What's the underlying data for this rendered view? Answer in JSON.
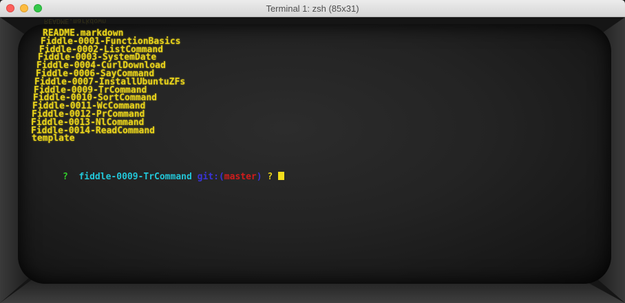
{
  "window": {
    "title": "Terminal 1: zsh (85x31)"
  },
  "terminal": {
    "ghost": "README.markdown",
    "lines": [
      "README.markdown",
      "Fiddle-0001-FunctionBasics",
      "Fiddle-0002-ListCommand",
      "Fiddle-0003-SystemDate",
      "Fiddle-0004-CurlDownload",
      "Fiddle-0006-SayCommand",
      "Fiddle-0007-InstallUbuntuZFs",
      "Fiddle-0009-TrCommand",
      "Fiddle-0010-SortCommand",
      "Fiddle-0011-WcCommand",
      "Fiddle-0012-PrCommand",
      "Fiddle-0013-NlCommand",
      "Fiddle-0014-ReadCommand",
      "template"
    ],
    "prompt": {
      "arrow": "?",
      "dir": "fiddle-0009-TrCommand",
      "git_prefix": "git:(",
      "branch": "master",
      "git_suffix": ")",
      "dirty_mark": "?"
    }
  },
  "colors": {
    "text": "#e8d21a",
    "prompt_arrow": "#32d12b",
    "prompt_dir": "#22c6d8",
    "git": "#3a34d8",
    "branch": "#d21c1c"
  }
}
